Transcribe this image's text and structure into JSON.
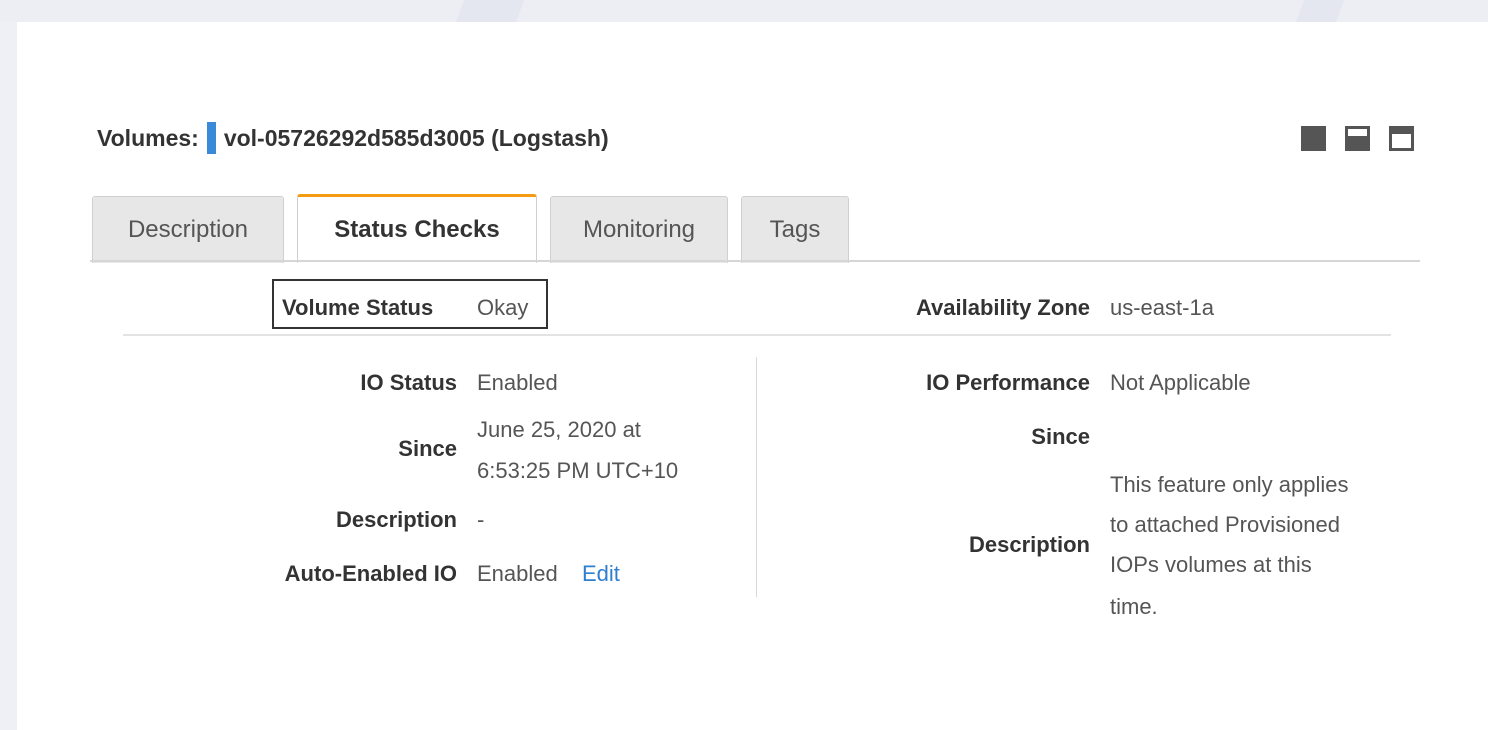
{
  "header": {
    "label": "Volumes:",
    "volume": "vol-05726292d585d3005 (Logstash)"
  },
  "window_icons": [
    "panel-full-icon",
    "panel-split-icon",
    "panel-min-icon"
  ],
  "tabs": [
    {
      "label": "Description",
      "active": false
    },
    {
      "label": "Status Checks",
      "active": true
    },
    {
      "label": "Monitoring",
      "active": false
    },
    {
      "label": "Tags",
      "active": false
    }
  ],
  "left": {
    "volume_status_label": "Volume Status",
    "volume_status_value": "Okay",
    "io_status_label": "IO Status",
    "io_status_value": "Enabled",
    "since_label": "Since",
    "since_value_line1": "June 25, 2020 at",
    "since_value_line2": "6:53:25 PM UTC+10",
    "description_label": "Description",
    "description_value": "-",
    "auto_enabled_label": "Auto-Enabled IO",
    "auto_enabled_value": "Enabled",
    "edit_link": "Edit"
  },
  "right": {
    "az_label": "Availability Zone",
    "az_value": "us-east-1a",
    "io_perf_label": "IO Performance",
    "io_perf_value": "Not Applicable",
    "since_label": "Since",
    "description_label": "Description",
    "description_lines": [
      "This feature only applies",
      "to attached Provisioned",
      "IOPs volumes at this",
      "time."
    ]
  },
  "colors": {
    "accent_tab": "#f39c12",
    "marker": "#3b8ad9",
    "link": "#2f7fd1"
  }
}
